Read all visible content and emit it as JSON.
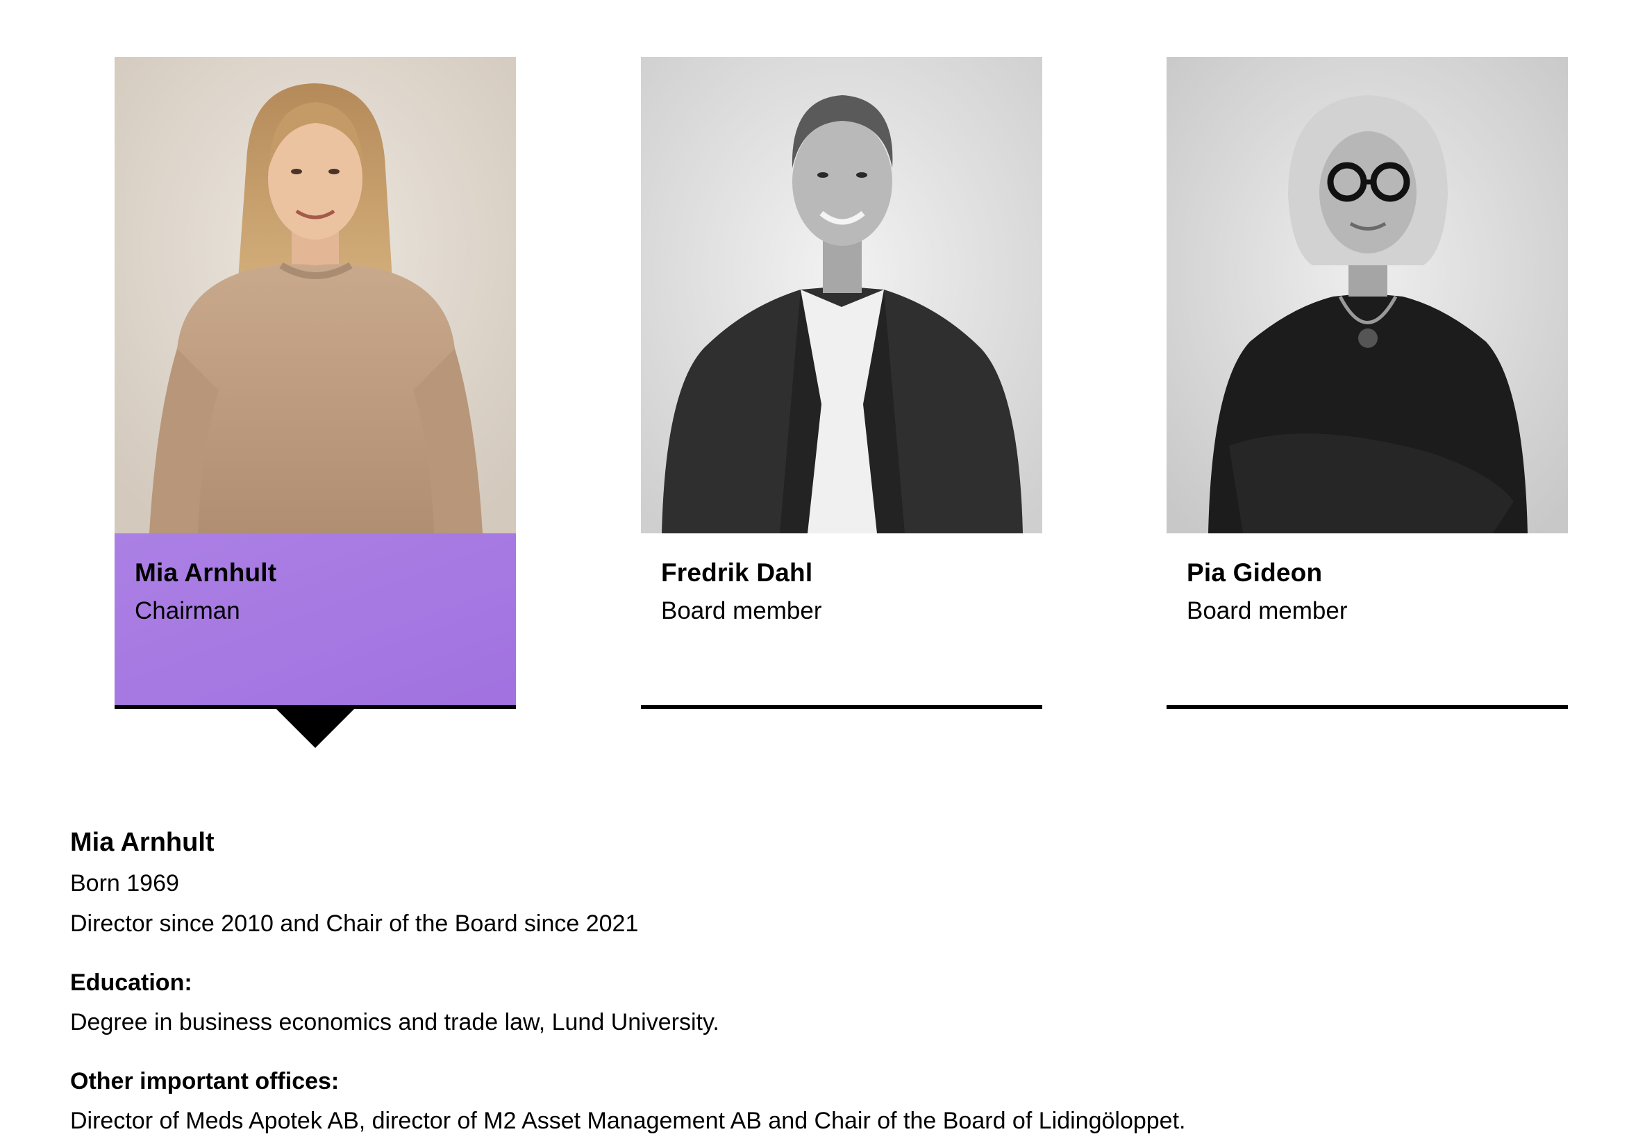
{
  "board": {
    "members": [
      {
        "name": "Mia Arnhult",
        "role": "Chairman",
        "selected": true,
        "photo_style": "color"
      },
      {
        "name": "Fredrik Dahl",
        "role": "Board member",
        "selected": false,
        "photo_style": "grayscale"
      },
      {
        "name": "Pia Gideon",
        "role": "Board member",
        "selected": false,
        "photo_style": "grayscale"
      }
    ]
  },
  "detail": {
    "name": "Mia Arnhult",
    "born": "Born 1969",
    "tenure": "Director since 2010 and Chair of the Board since 2021",
    "education_heading": "Education:",
    "education": "Degree in business economics and trade law, Lund University.",
    "offices_heading": "Other important offices:",
    "offices": "Director of Meds Apotek AB, director of M2 Asset Management AB and Chair of the Board of Lidingöloppet."
  },
  "colors": {
    "active_card": "#a577e2",
    "underline": "#000000",
    "text": "#000000",
    "background": "#ffffff"
  }
}
